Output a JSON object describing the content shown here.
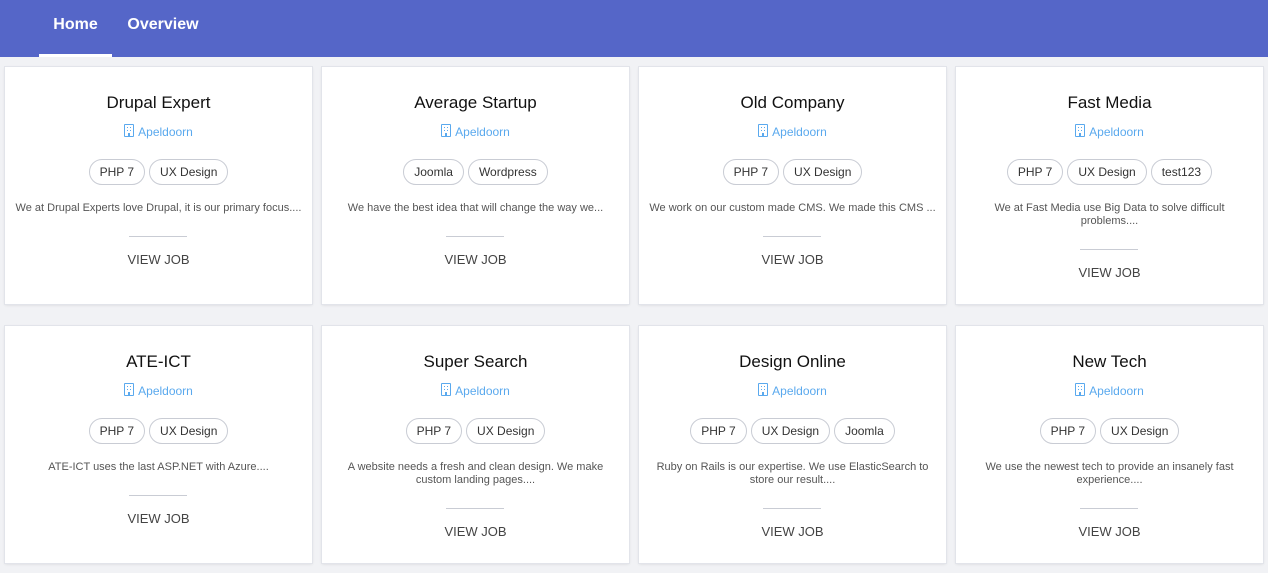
{
  "nav": {
    "tabs": [
      {
        "label": "Home",
        "active": true
      },
      {
        "label": "Overview",
        "active": false
      }
    ]
  },
  "colors": {
    "navbar": "#5566c8",
    "location": "#5aa9ee",
    "background": "#f1f2f5"
  },
  "cards": [
    {
      "name": "Drupal Expert",
      "location": "Apeldoorn",
      "tags": [
        "PHP 7",
        "UX Design"
      ],
      "description": "We at Drupal Experts love Drupal, it is our primary focus....",
      "action": "VIEW JOB"
    },
    {
      "name": "Average Startup",
      "location": "Apeldoorn",
      "tags": [
        "Joomla",
        "Wordpress"
      ],
      "description": "We have the best idea that will change the way we...",
      "action": "VIEW JOB"
    },
    {
      "name": "Old Company",
      "location": "Apeldoorn",
      "tags": [
        "PHP 7",
        "UX Design"
      ],
      "description": "We work on our custom made CMS. We made this CMS ...",
      "action": "VIEW JOB"
    },
    {
      "name": "Fast Media",
      "location": "Apeldoorn",
      "tags": [
        "PHP 7",
        "UX Design",
        "test123"
      ],
      "description": "We at Fast Media use Big Data to solve difficult problems....",
      "action": "VIEW JOB"
    },
    {
      "name": "ATE-ICT",
      "location": "Apeldoorn",
      "tags": [
        "PHP 7",
        "UX Design"
      ],
      "description": "ATE-ICT uses the last ASP.NET with Azure....",
      "action": "VIEW JOB"
    },
    {
      "name": "Super Search",
      "location": "Apeldoorn",
      "tags": [
        "PHP 7",
        "UX Design"
      ],
      "description": "A website needs a fresh and clean design. We make custom landing pages....",
      "action": "VIEW JOB"
    },
    {
      "name": "Design Online",
      "location": "Apeldoorn",
      "tags": [
        "PHP 7",
        "UX Design",
        "Joomla"
      ],
      "description": "Ruby on Rails is our expertise. We use ElasticSearch to store our result....",
      "action": "VIEW JOB"
    },
    {
      "name": "New Tech",
      "location": "Apeldoorn",
      "tags": [
        "PHP 7",
        "UX Design"
      ],
      "description": "We use the newest tech to provide an insanely fast experience....",
      "action": "VIEW JOB"
    }
  ]
}
